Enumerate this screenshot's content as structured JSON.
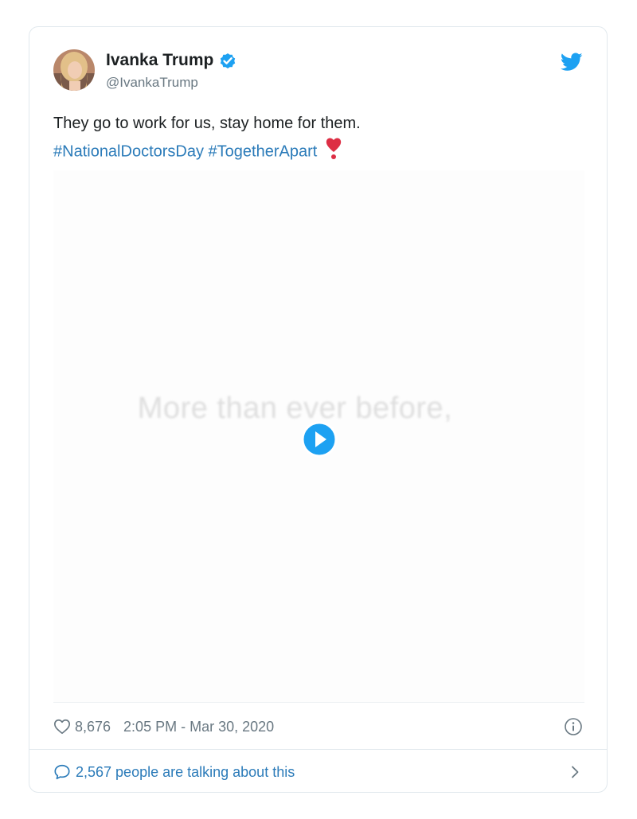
{
  "author": {
    "name": "Ivanka Trump",
    "handle": "@IvankaTrump",
    "verified_icon": "verified-badge-icon",
    "avatar_icon": "avatar"
  },
  "brand": {
    "logo_icon": "twitter-bird-icon",
    "accent_color": "#1da1f2",
    "link_color": "#2b7bb9"
  },
  "tweet": {
    "text": "They go to work for us, stay home for them.",
    "hashtags": [
      "#NationalDoctorsDay",
      "#TogetherApart"
    ],
    "emoji": "❣️"
  },
  "media": {
    "caption": "More than ever before,",
    "play_icon": "play-icon"
  },
  "meta": {
    "like_icon": "heart-icon",
    "like_count": "8,676",
    "timestamp": "2:05 PM - Mar 30, 2020",
    "info_icon": "info-icon"
  },
  "conversation": {
    "icon": "reply-bubble-icon",
    "text": "2,567 people are talking about this",
    "chevron_icon": "chevron-right-icon"
  }
}
